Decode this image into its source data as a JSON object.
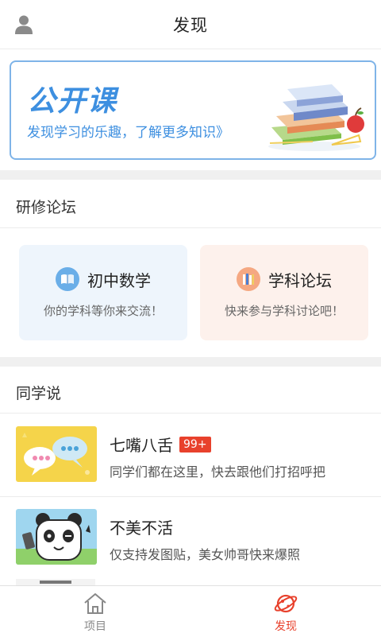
{
  "header": {
    "title": "发现",
    "avatar_icon": "person-icon"
  },
  "banner": {
    "title": "公开课",
    "subtitle": "发现学习的乐趣，了解更多知识》"
  },
  "forum": {
    "section_title": "研修论坛",
    "cards": [
      {
        "title": "初中数学",
        "desc": "你的学科等你来交流！",
        "icon": "book-icon",
        "bg": "#eef5fc",
        "icon_color": "#6aaee8"
      },
      {
        "title": "学科论坛",
        "desc": "快来参与学科讨论吧！",
        "icon": "books-icon",
        "bg": "#fdf1ec",
        "icon_color": "#f5a882"
      }
    ]
  },
  "classmates": {
    "section_title": "同学说",
    "items": [
      {
        "title": "七嘴八舌",
        "badge": "99+",
        "desc": "同学们都在这里，快去跟他们打招呼把"
      },
      {
        "title": "不美不活",
        "desc": "仅支持发图贴，美女帅哥快来爆照"
      }
    ]
  },
  "tabbar": {
    "tabs": [
      {
        "label": "项目",
        "icon": "home-icon",
        "active": false
      },
      {
        "label": "发现",
        "icon": "planet-icon",
        "active": true
      }
    ],
    "active_color": "#e8412c",
    "inactive_color": "#888888"
  }
}
